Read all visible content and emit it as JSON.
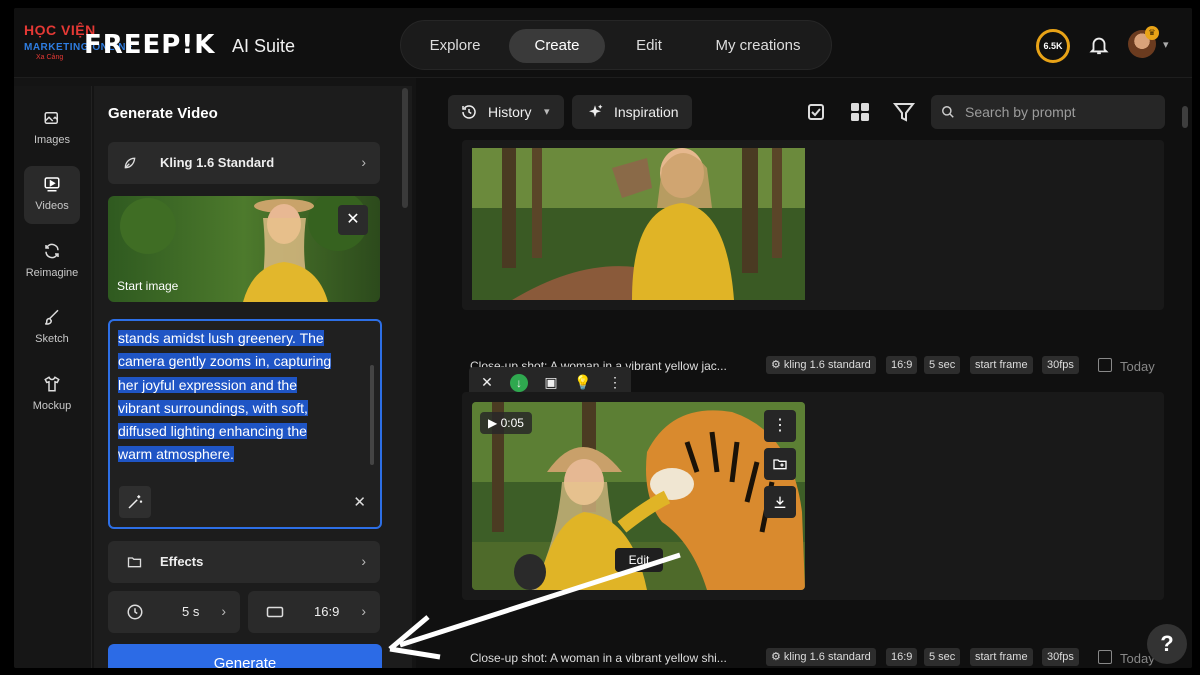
{
  "branding": {
    "watermark_line1": "HỌC VIỆN",
    "watermark_line2": "MARKETING ONLINE",
    "watermark_line3": "Xa Cảng",
    "logo": "FREEP!K",
    "product": "AI Suite"
  },
  "nav": {
    "items": [
      "Explore",
      "Create",
      "Edit",
      "My creations"
    ],
    "active": "Create"
  },
  "header": {
    "credits": "6.5K",
    "bell_icon": "bell-icon",
    "avatar_icon": "avatar-icon"
  },
  "tools": [
    {
      "label": "Images",
      "icon": "image-icon"
    },
    {
      "label": "Videos",
      "icon": "video-icon"
    },
    {
      "label": "Reimagine",
      "icon": "refresh-icon"
    },
    {
      "label": "Sketch",
      "icon": "brush-icon"
    },
    {
      "label": "Mockup",
      "icon": "tshirt-icon"
    }
  ],
  "panel": {
    "title": "Generate Video",
    "model": "Kling 1.6 Standard",
    "start_image_label": "Start image",
    "prompt_lines": [
      "stands amidst lush greenery. The",
      "camera gently zooms in, capturing",
      "her joyful expression and the",
      "vibrant surroundings, with soft,",
      "diffused lighting enhancing the",
      "warm atmosphere."
    ],
    "effects_label": "Effects",
    "duration": "5 s",
    "aspect": "16:9",
    "generate_label": "Generate"
  },
  "toolbar": {
    "history_label": "History",
    "inspiration_label": "Inspiration",
    "search_placeholder": "Search by prompt"
  },
  "items": [
    {
      "caption": "Close-up shot: A woman in a vibrant yellow jac...",
      "tags": [
        "kling 1.6 standard",
        "16:9",
        "5 sec",
        "start frame",
        "30fps"
      ],
      "date": "Today"
    },
    {
      "caption": "Close-up shot: A woman in a vibrant yellow shi...",
      "tags": [
        "kling 1.6 standard",
        "16:9",
        "5 sec",
        "start frame",
        "30fps"
      ],
      "date": "Today"
    }
  ],
  "video": {
    "duration": "0:05",
    "edit_label": "Edit"
  },
  "help_label": "?",
  "colors": {
    "accent": "#2c6be6",
    "credits_ring": "#e8a317",
    "download_green": "#2fa84f"
  }
}
